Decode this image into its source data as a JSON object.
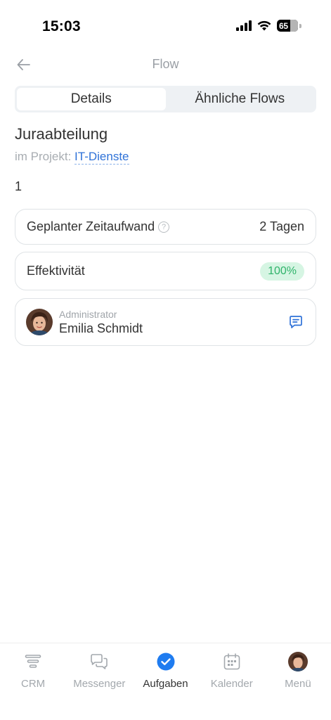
{
  "status_bar": {
    "time": "15:03",
    "battery": "65"
  },
  "header": {
    "title": "Flow"
  },
  "tabs": [
    {
      "label": "Details",
      "active": true
    },
    {
      "label": "Ähnliche Flows",
      "active": false
    }
  ],
  "flow": {
    "name": "Juraabteilung",
    "project_prefix": "im Projekt:",
    "project_name": "IT-Dienste",
    "description": "1"
  },
  "planned_time": {
    "label": "Geplanter Zeitaufwand",
    "value": "2 Tagen",
    "icon": "help-icon"
  },
  "effectiveness": {
    "label": "Effektivität",
    "value": "100%",
    "badge_bg": "#d6f5e3",
    "badge_color": "#2fb36a"
  },
  "administrator": {
    "role": "Administrator",
    "name": "Emilia Schmidt"
  },
  "nav": {
    "items": [
      {
        "label": "CRM",
        "icon": "crm-funnel-icon"
      },
      {
        "label": "Messenger",
        "icon": "chat-bubbles-icon"
      },
      {
        "label": "Aufgaben",
        "icon": "check-circle-icon",
        "active": true
      },
      {
        "label": "Kalender",
        "icon": "calendar-icon"
      },
      {
        "label": "Menü",
        "icon": "avatar-icon"
      }
    ]
  },
  "colors": {
    "accent": "#2f72d8",
    "active_nav": "#1f7cf0",
    "muted": "#a3a8ad"
  }
}
